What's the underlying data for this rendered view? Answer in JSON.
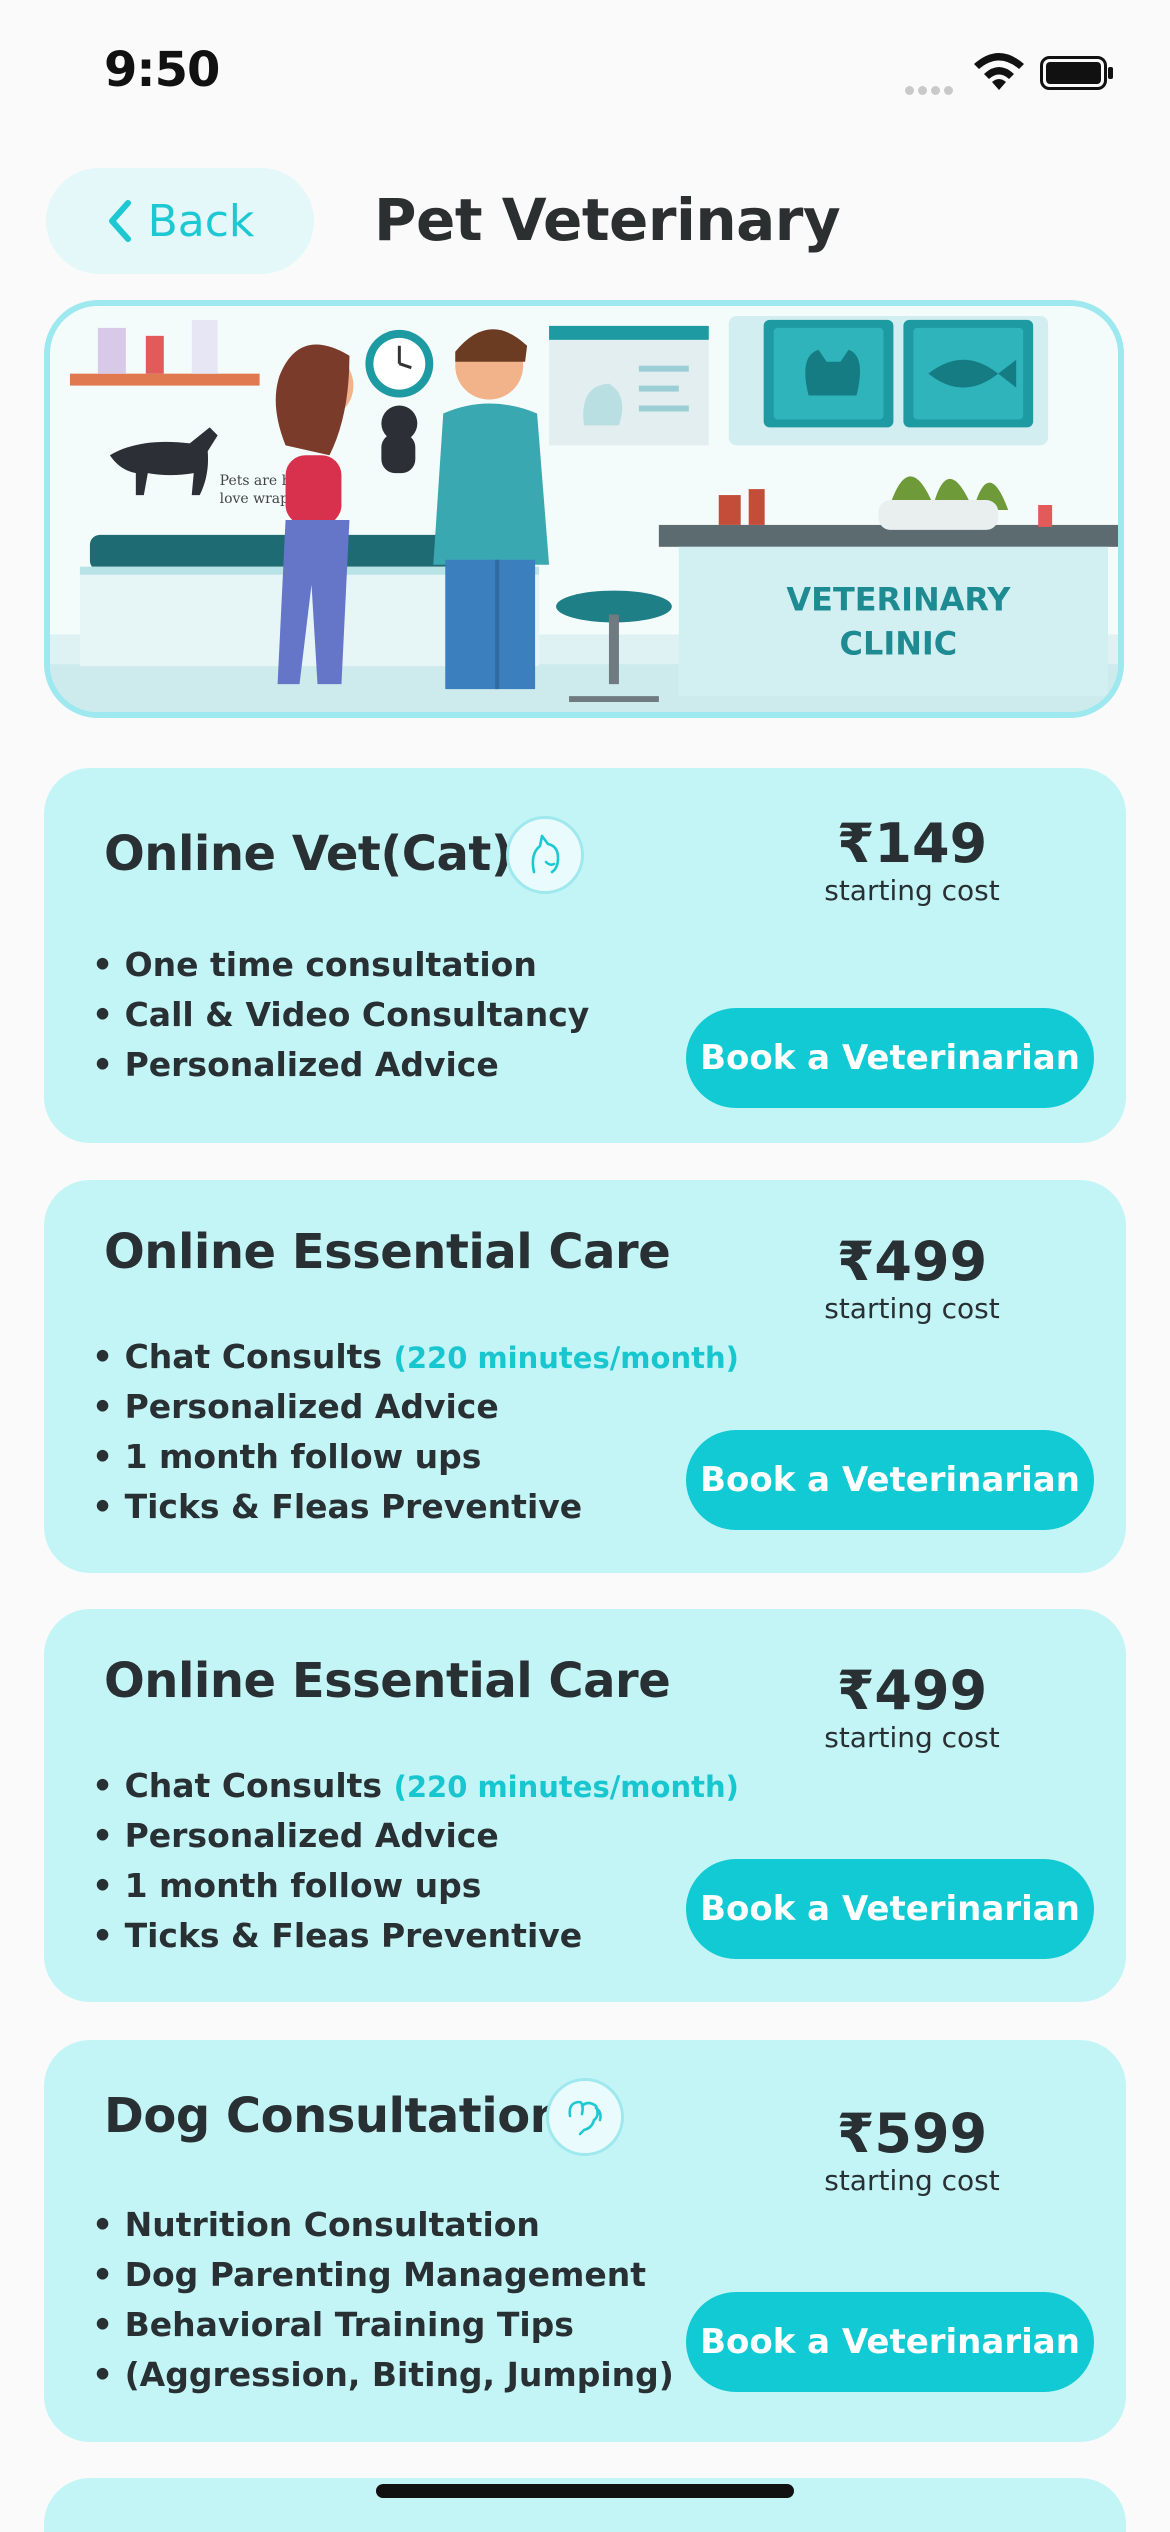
{
  "status_bar": {
    "time": "9:50"
  },
  "header": {
    "back_label": "Back",
    "title": "Pet Veterinary"
  },
  "hero": {
    "sign_line1": "VETERINARY",
    "sign_line2": "CLINIC",
    "poster_line1": "Pets are huma",
    "poster_line2": "love wrapp"
  },
  "cards": [
    {
      "title": "Online Vet(Cat)",
      "icon": "cat-icon",
      "price": "₹149",
      "price_sub": "starting cost",
      "features": [
        "• One time consultation",
        "• Call & Video Consultancy",
        "• Personalized Advice"
      ],
      "button": "Book a Veterinarian"
    },
    {
      "title": "Online Essential Care",
      "price": "₹499",
      "price_sub": "starting cost",
      "features_first_prefix": "• Chat Consults",
      "features_first_highlight": "(220 minutes/month)",
      "features": [
        "• Personalized Advice",
        "• 1 month follow ups",
        "• Ticks & Fleas Preventive"
      ],
      "button": "Book a Veterinarian"
    },
    {
      "title": "Online Essential Care",
      "price": "₹499",
      "price_sub": "starting cost",
      "features_first_prefix": "• Chat Consults",
      "features_first_highlight": "(220 minutes/month)",
      "features": [
        "• Personalized Advice",
        "• 1 month follow ups",
        "• Ticks & Fleas Preventive"
      ],
      "button": "Book a Veterinarian"
    },
    {
      "title": "Dog Consultation",
      "icon": "dog-icon",
      "price": "₹599",
      "price_sub": "starting cost",
      "features": [
        "• Nutrition Consultation",
        "• Dog Parenting Management",
        "• Behavioral Training Tips",
        "• (Aggression, Biting, Jumping)"
      ],
      "button": "Book a Veterinarian"
    }
  ],
  "colors": {
    "accent": "#11cad4",
    "card_bg": "#c3f5f7",
    "text": "#283033",
    "highlight": "#18c6cf"
  }
}
